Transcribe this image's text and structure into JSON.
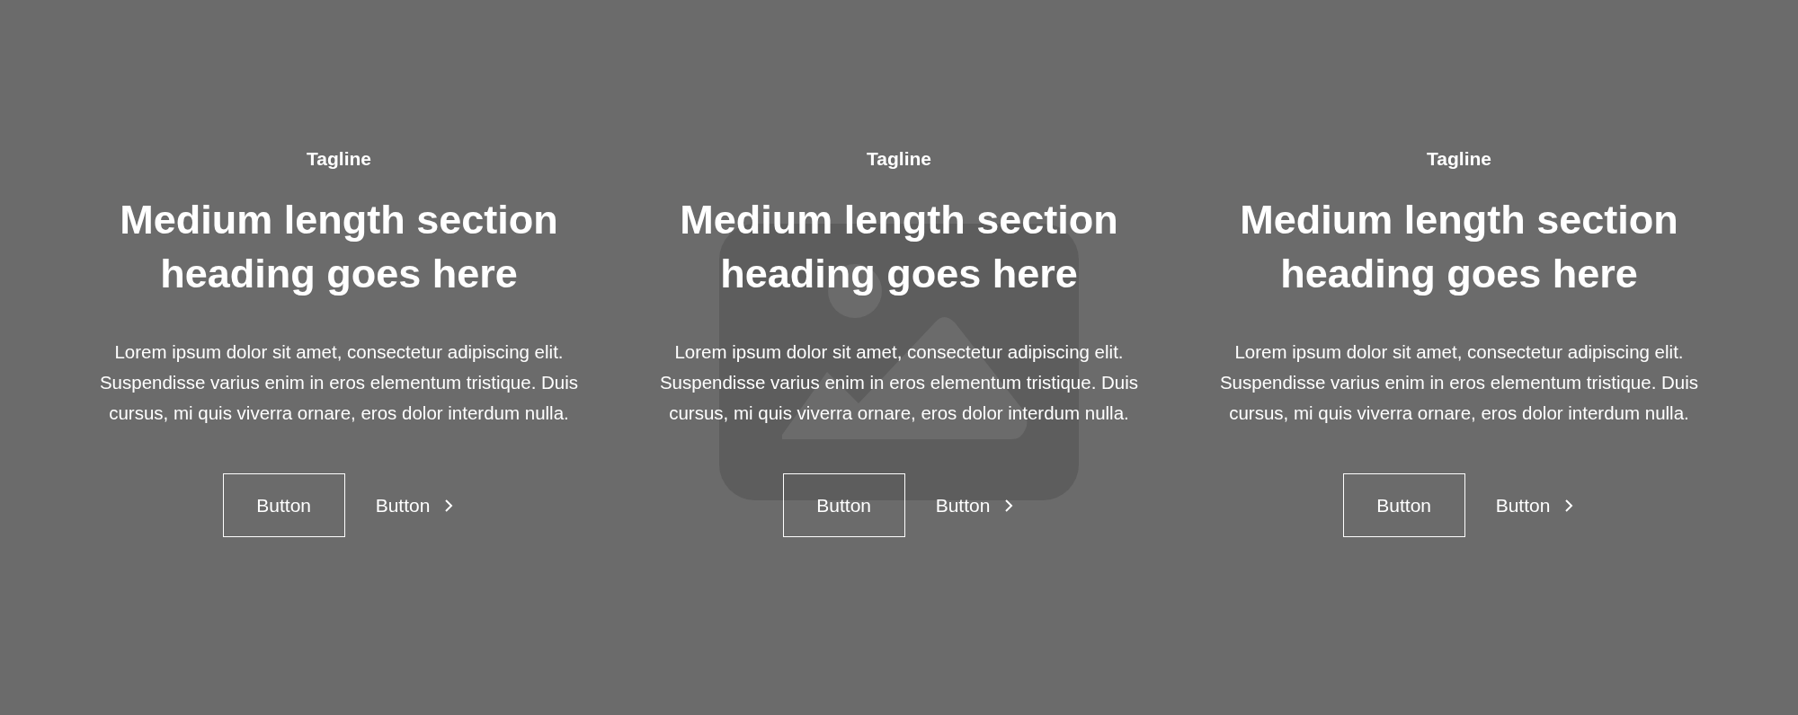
{
  "sections": [
    {
      "tagline": "Tagline",
      "heading": "Medium length section heading goes here",
      "body": "Lorem ipsum dolor sit amet, consectetur adipiscing elit. Suspendisse varius enim in eros elementum tristique. Duis cursus, mi quis viverra ornare, eros dolor interdum nulla.",
      "buttons": [
        {
          "label": "Button",
          "kind": "outline"
        },
        {
          "label": "Button",
          "kind": "link"
        }
      ]
    },
    {
      "tagline": "Tagline",
      "heading": "Medium length section heading goes here",
      "body": "Lorem ipsum dolor sit amet, consectetur adipiscing elit. Suspendisse varius enim in eros elementum tristique. Duis cursus, mi quis viverra ornare, eros dolor interdum nulla.",
      "buttons": [
        {
          "label": "Button",
          "kind": "outline"
        },
        {
          "label": "Button",
          "kind": "link"
        }
      ]
    },
    {
      "tagline": "Tagline",
      "heading": "Medium length section heading goes here",
      "body": "Lorem ipsum dolor sit amet, consectetur adipiscing elit. Suspendisse varius enim in eros elementum tristique. Duis cursus, mi quis viverra ornare, eros dolor interdum nulla.",
      "buttons": [
        {
          "label": "Button",
          "kind": "outline"
        },
        {
          "label": "Button",
          "kind": "link"
        }
      ]
    }
  ]
}
